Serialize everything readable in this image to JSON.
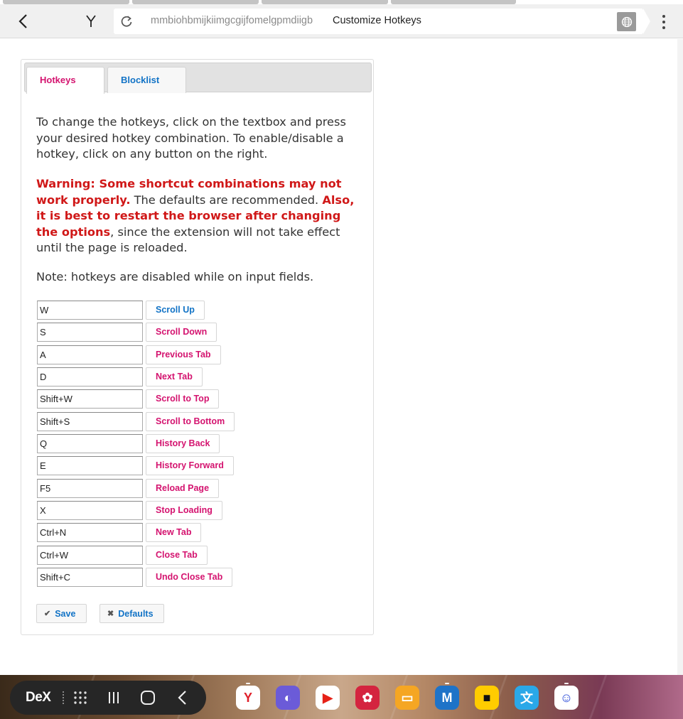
{
  "browser": {
    "url_host": "mmbiohbmijkiimgcgijfomelgpmdiigb",
    "page_title": "Customize Hotkeys"
  },
  "options": {
    "tabs": [
      {
        "label": "Hotkeys",
        "active": true
      },
      {
        "label": "Blocklist",
        "active": false
      }
    ],
    "intro": "To change the hotkeys, click on the textbox and press your desired hotkey combination. To enable/disable a hotkey, click on any button on the right.",
    "warning": {
      "part1": "Warning: Some shortcut combinations may not work properly.",
      "part2": " The defaults are recommended. ",
      "part3": "Also, it is best to restart the browser after changing the options",
      "part4": ", since the extension will not take effect until the page is reloaded."
    },
    "note": "Note: hotkeys are disabled while on input fields.",
    "hotkeys": [
      {
        "key": "W",
        "action": "Scroll Up",
        "enabled": true
      },
      {
        "key": "S",
        "action": "Scroll Down",
        "enabled": false
      },
      {
        "key": "A",
        "action": "Previous Tab",
        "enabled": false
      },
      {
        "key": "D",
        "action": "Next Tab",
        "enabled": false
      },
      {
        "key": "Shift+W",
        "action": "Scroll to Top",
        "enabled": false
      },
      {
        "key": "Shift+S",
        "action": "Scroll to Bottom",
        "enabled": false
      },
      {
        "key": "Q",
        "action": "History Back",
        "enabled": false
      },
      {
        "key": "E",
        "action": "History Forward",
        "enabled": false
      },
      {
        "key": "F5",
        "action": "Reload Page",
        "enabled": false
      },
      {
        "key": "X",
        "action": "Stop Loading",
        "enabled": false
      },
      {
        "key": "Ctrl+N",
        "action": "New Tab",
        "enabled": false
      },
      {
        "key": "Ctrl+W",
        "action": "Close Tab",
        "enabled": false
      },
      {
        "key": "Shift+C",
        "action": "Undo Close Tab",
        "enabled": false
      }
    ],
    "save_label": "Save",
    "defaults_label": "Defaults"
  },
  "taskbar": {
    "dex_label": "DeX",
    "apps": [
      {
        "name": "yandex-browser",
        "color": "#ffffff",
        "glyph": "Y",
        "glyph_color": "#e0202a"
      },
      {
        "name": "samsung-internet",
        "color": "#6b5bd8",
        "glyph": "◐",
        "glyph_color": "#ffffff"
      },
      {
        "name": "youtube",
        "color": "#ffffff",
        "glyph": "▶",
        "glyph_color": "#e62117"
      },
      {
        "name": "bixby-gallery",
        "color": "#d4243f",
        "glyph": "✿",
        "glyph_color": "#ffffff"
      },
      {
        "name": "my-files",
        "color": "#f5a623",
        "glyph": "▭",
        "glyph_color": "#ffffff"
      },
      {
        "name": "infinite-painter",
        "color": "#1e73c8",
        "glyph": "M",
        "glyph_color": "#ffffff"
      },
      {
        "name": "notes",
        "color": "#ffcc00",
        "glyph": "■",
        "glyph_color": "#111111"
      },
      {
        "name": "translate",
        "color": "#2aa8e8",
        "glyph": "文",
        "glyph_color": "#ffffff"
      },
      {
        "name": "mascot-app",
        "color": "#ffffff",
        "glyph": "☺",
        "glyph_color": "#2a4ad8"
      }
    ]
  }
}
